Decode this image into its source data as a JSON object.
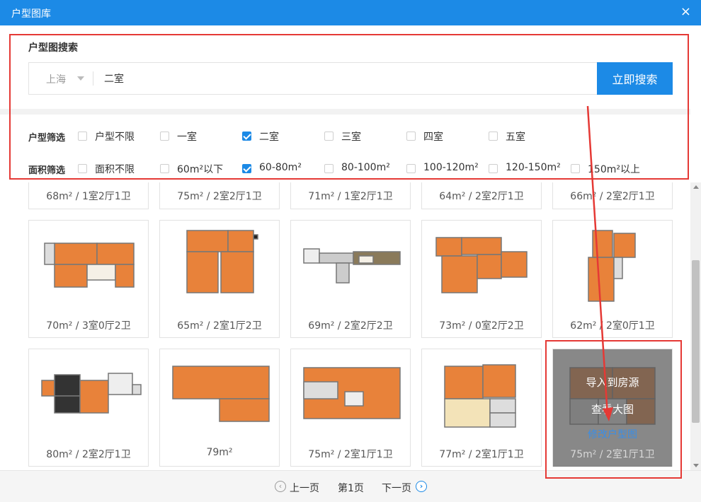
{
  "window": {
    "title": "户型图库",
    "close_glyph": "×"
  },
  "search": {
    "section_title": "户型图搜索",
    "city": "上海",
    "query": "二室",
    "button_label": "立即搜索"
  },
  "filters": {
    "room": {
      "label": "户型筛选",
      "options": [
        {
          "label": "户型不限",
          "checked": false
        },
        {
          "label": "一室",
          "checked": false
        },
        {
          "label": "二室",
          "checked": true
        },
        {
          "label": "三室",
          "checked": false
        },
        {
          "label": "四室",
          "checked": false
        },
        {
          "label": "五室",
          "checked": false
        }
      ]
    },
    "area": {
      "label": "面积筛选",
      "options": [
        {
          "label": "面积不限",
          "checked": false
        },
        {
          "label": "60m²以下",
          "checked": false
        },
        {
          "label": "60-80m²",
          "checked": true
        },
        {
          "label": "80-100m²",
          "checked": false
        },
        {
          "label": "100-120m²",
          "checked": false
        },
        {
          "label": "120-150m²",
          "checked": false
        },
        {
          "label": "150m²以上",
          "checked": false
        }
      ]
    }
  },
  "colors": {
    "accent": "#1c8ae6",
    "floor": "#e8823a",
    "annotation": "#e53935"
  },
  "listings": {
    "top_row": [
      "68m² / 1室2厅1卫",
      "75m² / 2室2厅1卫",
      "71m² / 1室2厅1卫",
      "64m² / 2室2厅1卫",
      "66m² / 2室2厅1卫"
    ],
    "middle_row": [
      "70m² / 3室0厅2卫",
      "65m² / 2室1厅2卫",
      "69m² / 2室2厅2卫",
      "73m² / 0室2厅2卫",
      "62m² / 2室0厅1卫"
    ],
    "bottom_row": [
      "80m² / 2室2厅1卫",
      "79m²",
      "75m² / 2室1厅1卫",
      "77m² / 2室1厅1卫",
      "75m² / 2室1厅1卫"
    ]
  },
  "hover_card": {
    "import_label": "导入到房源",
    "view_label": "查看大图",
    "edit_label": "修改户型图"
  },
  "pagination": {
    "prev_label": "上一页",
    "current_label": "第1页",
    "next_label": "下一页"
  }
}
